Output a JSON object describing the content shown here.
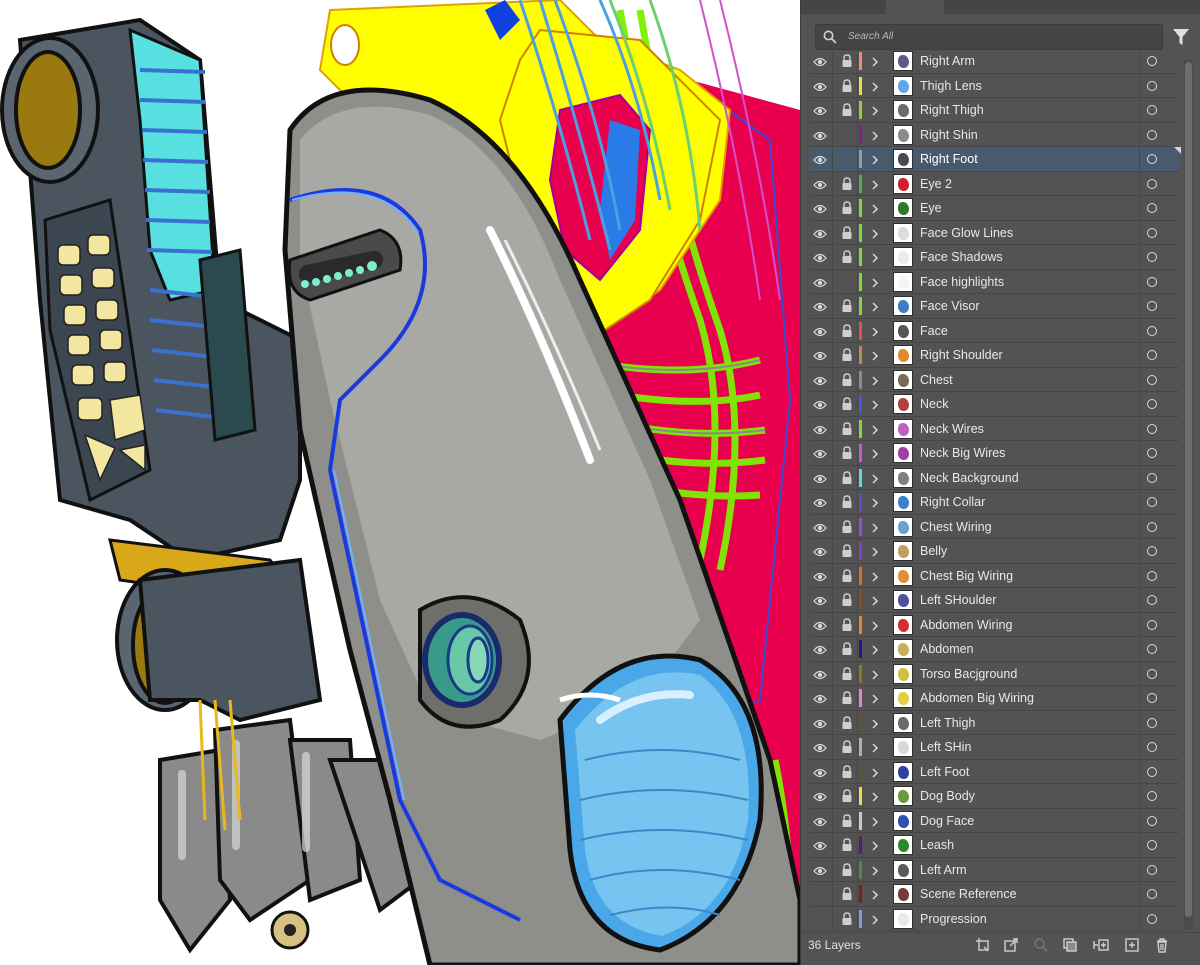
{
  "search": {
    "placeholder": "Search All"
  },
  "footer": {
    "layer_count": "36 Layers"
  },
  "layers": [
    {
      "name": "Right Arm",
      "color": "#ff8080",
      "visible": true,
      "locked": true,
      "selected": false,
      "thumb": "#5b5b8a"
    },
    {
      "name": "Thigh Lens",
      "color": "#e8e24a",
      "visible": true,
      "locked": true,
      "selected": false,
      "thumb": "#5fa8e6"
    },
    {
      "name": "Right Thigh",
      "color": "#9acd32",
      "visible": true,
      "locked": true,
      "selected": false,
      "thumb": "#6b6b6b"
    },
    {
      "name": "Right Shin",
      "color": "#8b1a8b",
      "visible": true,
      "locked": false,
      "selected": false,
      "thumb": "#8a8a8a"
    },
    {
      "name": "Right Foot",
      "color": "#9a9a9a",
      "visible": true,
      "locked": false,
      "selected": true,
      "thumb": "#4a4a4a"
    },
    {
      "name": "Eye 2",
      "color": "#4caf50",
      "visible": true,
      "locked": true,
      "selected": false,
      "thumb": "#d0202a"
    },
    {
      "name": "Eye",
      "color": "#7cdc3a",
      "visible": true,
      "locked": true,
      "selected": false,
      "thumb": "#2c7a2c"
    },
    {
      "name": "Face Glow Lines",
      "color": "#7cdc3a",
      "visible": true,
      "locked": true,
      "selected": false,
      "thumb": "#dcdcdc"
    },
    {
      "name": "Face Shadows",
      "color": "#7cdc3a",
      "visible": true,
      "locked": true,
      "selected": false,
      "thumb": "#eaeaea"
    },
    {
      "name": "Face highlights",
      "color": "#7cdc3a",
      "visible": true,
      "locked": false,
      "selected": false,
      "thumb": "#f4f4f4"
    },
    {
      "name": "Face Visor",
      "color": "#7cdc3a",
      "visible": true,
      "locked": true,
      "selected": false,
      "thumb": "#3b7fc4"
    },
    {
      "name": "Face",
      "color": "#e05050",
      "visible": true,
      "locked": true,
      "selected": false,
      "thumb": "#555555"
    },
    {
      "name": "Right Shoulder",
      "color": "#c08a4a",
      "visible": true,
      "locked": true,
      "selected": false,
      "thumb": "#e08a2a"
    },
    {
      "name": "Chest",
      "color": "#8a8a8a",
      "visible": true,
      "locked": true,
      "selected": false,
      "thumb": "#7a6a5a"
    },
    {
      "name": "Neck",
      "color": "#5050e0",
      "visible": true,
      "locked": true,
      "selected": false,
      "thumb": "#b04040"
    },
    {
      "name": "Neck Wires",
      "color": "#7cdc3a",
      "visible": true,
      "locked": true,
      "selected": false,
      "thumb": "#c060c0"
    },
    {
      "name": "Neck Big Wires",
      "color": "#d050d0",
      "visible": true,
      "locked": true,
      "selected": false,
      "thumb": "#a040a0"
    },
    {
      "name": "Neck Background",
      "color": "#50e0e0",
      "visible": true,
      "locked": true,
      "selected": false,
      "thumb": "#808080"
    },
    {
      "name": "Right Collar",
      "color": "#5050c0",
      "visible": true,
      "locked": true,
      "selected": false,
      "thumb": "#3a80d0"
    },
    {
      "name": "Chest Wiring",
      "color": "#9050d0",
      "visible": true,
      "locked": true,
      "selected": false,
      "thumb": "#6aa0d0"
    },
    {
      "name": "Belly",
      "color": "#8040c0",
      "visible": true,
      "locked": true,
      "selected": false,
      "thumb": "#c0a060"
    },
    {
      "name": "Chest Big Wiring",
      "color": "#e07020",
      "visible": true,
      "locked": true,
      "selected": false,
      "thumb": "#e09030"
    },
    {
      "name": "Left SHoulder",
      "color": "#8a4a1a",
      "visible": true,
      "locked": true,
      "selected": false,
      "thumb": "#5050a0"
    },
    {
      "name": "Abdomen Wiring",
      "color": "#e08a20",
      "visible": true,
      "locked": true,
      "selected": false,
      "thumb": "#d03030"
    },
    {
      "name": "Abdomen",
      "color": "#1a1a8a",
      "visible": true,
      "locked": true,
      "selected": false,
      "thumb": "#c8b060"
    },
    {
      "name": "Torso Bacjground",
      "color": "#8a7a1a",
      "visible": true,
      "locked": true,
      "selected": false,
      "thumb": "#d0c040"
    },
    {
      "name": "Abdomen Big Wiring",
      "color": "#e08ac0",
      "visible": true,
      "locked": true,
      "selected": false,
      "thumb": "#e0d040"
    },
    {
      "name": "Left Thigh",
      "color": "#5a5a1a",
      "visible": true,
      "locked": true,
      "selected": false,
      "thumb": "#6a6a6a"
    },
    {
      "name": "Left SHin",
      "color": "#b0b0b0",
      "visible": true,
      "locked": true,
      "selected": false,
      "thumb": "#d8d8d8"
    },
    {
      "name": "Left Foot",
      "color": "#5a5a1a",
      "visible": true,
      "locked": true,
      "selected": false,
      "thumb": "#3040a0"
    },
    {
      "name": "Dog Body",
      "color": "#e8e24a",
      "visible": true,
      "locked": true,
      "selected": false,
      "thumb": "#6a9a3a"
    },
    {
      "name": "Dog Face",
      "color": "#c8c8c8",
      "visible": true,
      "locked": true,
      "selected": false,
      "thumb": "#3050b0"
    },
    {
      "name": "Leash",
      "color": "#5a1a7a",
      "visible": true,
      "locked": true,
      "selected": false,
      "thumb": "#2a8a2a"
    },
    {
      "name": "Left Arm",
      "color": "#4a8a4a",
      "visible": true,
      "locked": true,
      "selected": false,
      "thumb": "#5a5a5a"
    },
    {
      "name": "Scene Reference",
      "color": "#8a1a1a",
      "visible": false,
      "locked": true,
      "selected": false,
      "thumb": "#7a3a3a"
    },
    {
      "name": "Progression",
      "color": "#8a9ae0",
      "visible": false,
      "locked": true,
      "selected": false,
      "thumb": "#e8e8e8"
    }
  ]
}
